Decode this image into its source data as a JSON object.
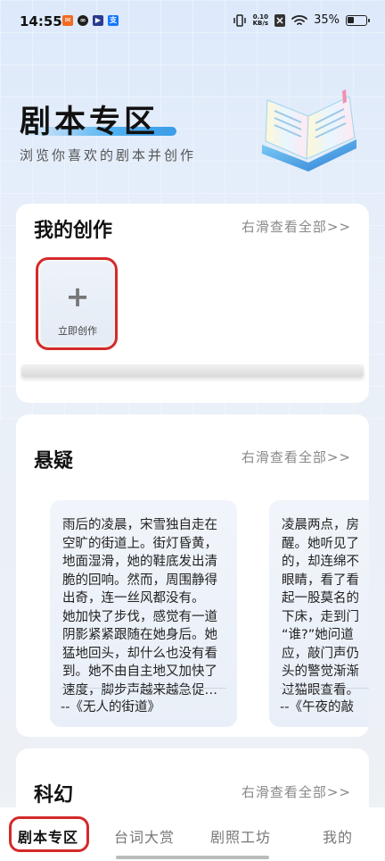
{
  "status_bar": {
    "time": "14:55",
    "net_speed_value": "0.10",
    "net_speed_unit": "KB/s",
    "battery": "35%",
    "icons": [
      "notification-app-icon",
      "notification-app-icon",
      "notification-app-icon",
      "alipay-icon",
      "vibrate-icon",
      "signal-icon",
      "wifi-icon",
      "battery-icon"
    ]
  },
  "header": {
    "title": "剧本专区",
    "subtitle": "浏览你喜欢的剧本并创作",
    "accent_color": "#3b9ce8"
  },
  "my_works": {
    "title": "我的创作",
    "more": "右滑查看全部>>",
    "create_label": "立即创作",
    "create_icon": "plus-icon"
  },
  "suspense": {
    "title": "悬疑",
    "more": "右滑查看全部>>",
    "stories": [
      {
        "lines": [
          "雨后的凌晨，宋雪独自走在",
          "空旷的街道上。街灯昏黄，",
          "地面湿滑，她的鞋底发出清",
          "脆的回响。然而，周围静得",
          "出奇，连一丝风都没有。",
          "她加快了步伐，感觉有一道",
          "阴影紧紧跟随在她身后。她",
          "猛地回头，却什么也没有看",
          "到。她不由自主地又加快了",
          "速度，脚步声越来越急促…"
        ],
        "title": "--《无人的街道》"
      },
      {
        "lines": [
          "凌晨两点，房",
          "醒。她听见了",
          "的，却连绵不",
          "眼睛，看了看",
          "起一股莫名的",
          "下床，走到门",
          "“谁?”她问道",
          "应，敲门声仍",
          "头的警觉渐渐",
          "过猫眼查看。"
        ],
        "title": "--《午夜的敲"
      }
    ]
  },
  "scifi": {
    "title": "科幻",
    "more": "右滑查看全部>>"
  },
  "bottom_nav": {
    "items": [
      "剧本专区",
      "台词大赏",
      "剧照工坊",
      "我的"
    ],
    "active_index": 0
  }
}
